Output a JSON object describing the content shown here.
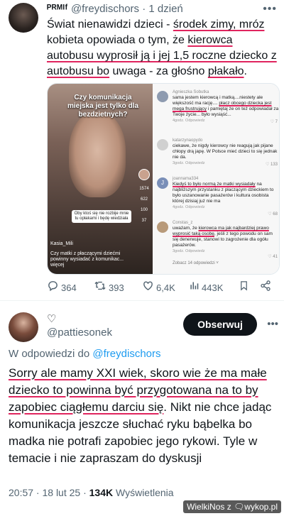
{
  "tweet1": {
    "author_name": "ᴾᴿᴹᴵᶠ",
    "handle": "@freydischors",
    "time": "· 1 dzień",
    "text_parts": [
      "Świat nienawidzi dzieci - ",
      "środek zimy, mróz",
      " kobieta opowiada o tym, że ",
      "kierowca autobusu wyprosił ją i jej 1,5 roczne dziecko z autobusu bo",
      " uwaga - za głośno ",
      "płakało",
      "."
    ],
    "video": {
      "title": "Czy komunikacja miejska jest tylko dla bezdzietnych?",
      "sticker": "Oby ktoś się nie rozbije mnie tu opłakami i będę wiedziała",
      "username": "Kasia_Mili",
      "caption": "Czy matki z płaczącymi dziećmi powinny wysiadać z komunikac... więcej",
      "rail": [
        "1574",
        "622",
        "100",
        "37"
      ]
    },
    "comments": [
      {
        "name": "Agnieszka Sobutka",
        "text_a": "sama jestem kierowcą i matką....niestety ale większość ma rację.... ",
        "text_ul": "płacz obcego dziecka jest mega frustrujący",
        "text_b": " i pamiętaj że on też odpowiadał za Twoje życie... było wysiąść...",
        "meta": "4godz.   Odpowiedz",
        "likes": "♡ 7"
      },
      {
        "name": "katarzynaopydo",
        "text_a": "ciekawe, że nigdy kierowcy nie reagują jak pijane chłopy drą japę. W Polsce mieć dzieci to się jednak nie da.",
        "text_ul": "",
        "text_b": "",
        "meta": "3godz.   Odpowiedz",
        "likes": "♡ 133"
      },
      {
        "name": "joannama334",
        "text_a": "",
        "text_ul": "Kiedyś to było normą że matki wysiadały",
        "text_b": " na najbliższym przystanku z płaczącym dzieckiem to było uszanowanie pasażerów i kultura osobista której dzisiaj już nie ma",
        "meta": "4godz.   Odpowiedz",
        "likes": "♡ 68"
      },
      {
        "name": "Constas_z",
        "text_a": "uważam, że ",
        "text_ul": "kierowca ma jak najbardziej prawo wyprosić taką osobę",
        "text_b": ", jeśli z tego powodu on sam się denerwuje, stanowi to zagrożenie dla ogółu pasażerów.",
        "meta": "3godz.   Odpowiedz",
        "likes": "♡ 41"
      }
    ],
    "view_more": "Zobacz 14 odpowiedzi ˅",
    "actions": {
      "replies": "364",
      "reposts": "393",
      "likes": "6,4K",
      "views": "443K"
    }
  },
  "tweet2": {
    "author_name": "♡",
    "handle": "@pattiesonek",
    "follow_label": "Obserwuj",
    "reply_prefix": "W odpowiedzi do ",
    "reply_handle": "@freydischors",
    "text_ul": "Sorry ale mamy XXI wiek, skoro wie że ma małe dziecko to powinna być przygotowana na to by zapobiec ciągłemu darciu się",
    "text_rest": ". Nikt nie chce jadąc komunikacja jeszcze słuchać ryku bąbelka bo madka nie potrafi zapobiec jego rykowi. Tyle w temacie i nie zapraszam do dyskusji",
    "time": "20:57 · 18 lut 25 · ",
    "views_count": "134K",
    "views_label": " Wyświetlenia"
  },
  "watermark": "WielkiNos z 🗨wykop.pl",
  "colors": {
    "underline": "#e0245e",
    "link": "#1d9bf0",
    "muted": "#536471",
    "follow_bg": "#0f1419"
  },
  "icons": [
    "more-icon",
    "reply-icon",
    "repost-icon",
    "like-icon",
    "views-icon",
    "bookmark-icon",
    "share-icon"
  ]
}
